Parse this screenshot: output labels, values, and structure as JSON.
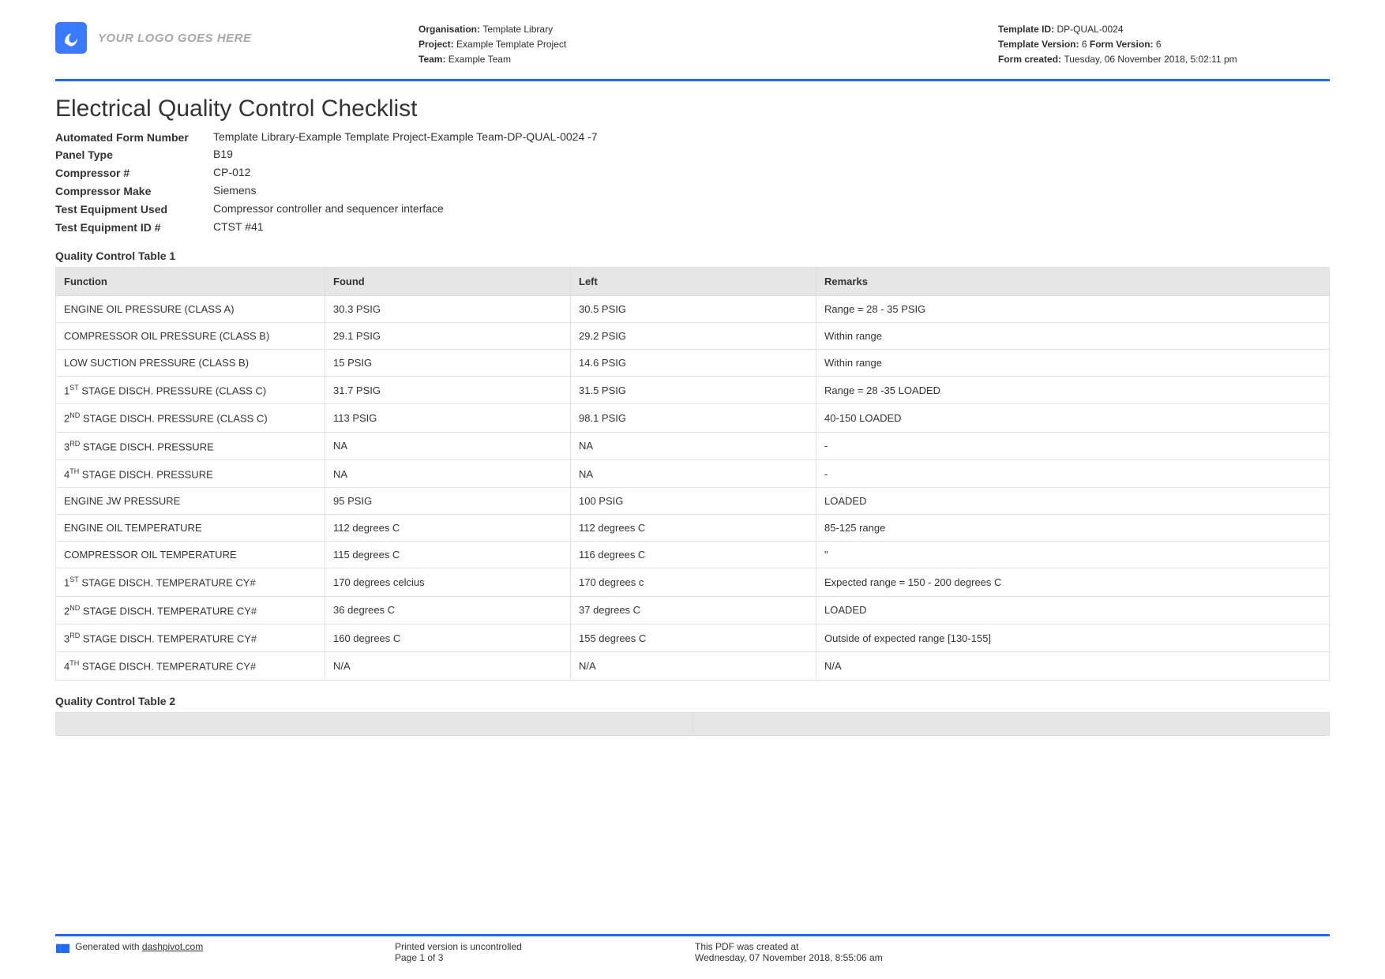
{
  "header": {
    "logo_placeholder": "YOUR LOGO GOES HERE",
    "org_label": "Organisation:",
    "org_value": "Template Library",
    "project_label": "Project:",
    "project_value": "Example Template Project",
    "team_label": "Team:",
    "team_value": "Example Team",
    "template_id_label": "Template ID:",
    "template_id_value": "DP-QUAL-0024",
    "template_version_label": "Template Version:",
    "template_version_value": "6",
    "form_version_label": "Form Version:",
    "form_version_value": "6",
    "form_created_label": "Form created:",
    "form_created_value": "Tuesday, 06 November 2018, 5:02:11 pm"
  },
  "title": "Electrical Quality Control Checklist",
  "fields": [
    {
      "k": "Automated Form Number",
      "v": "Template Library-Example Template Project-Example Team-DP-QUAL-0024   -7"
    },
    {
      "k": "Panel Type",
      "v": "B19"
    },
    {
      "k": "Compressor #",
      "v": "CP-012"
    },
    {
      "k": "Compressor Make",
      "v": "Siemens"
    },
    {
      "k": "Test Equipment Used",
      "v": "Compressor controller and sequencer interface"
    },
    {
      "k": "Test Equipment ID #",
      "v": "CTST #41"
    }
  ],
  "table1_title": "Quality Control Table 1",
  "table1_headers": [
    "Function",
    "Found",
    "Left",
    "Remarks"
  ],
  "table1_rows": [
    {
      "func": "ENGINE OIL PRESSURE (CLASS A)",
      "found": "30.3 PSIG",
      "left": "30.5 PSIG",
      "remarks": "Range = 28 - 35 PSIG"
    },
    {
      "func": "COMPRESSOR OIL PRESSURE (CLASS B)",
      "found": "29.1 PSIG",
      "left": "29.2 PSIG",
      "remarks": "Within range"
    },
    {
      "func": "LOW SUCTION PRESSURE (CLASS B)",
      "found": "15 PSIG",
      "left": "14.6 PSIG",
      "remarks": "Within range"
    },
    {
      "func": "1<sup>ST</sup> STAGE DISCH. PRESSURE (CLASS C)",
      "found": "31.7 PSIG",
      "left": "31.5 PSIG",
      "remarks": "Range = 28 -35 LOADED"
    },
    {
      "func": "2<sup>ND</sup> STAGE DISCH. PRESSURE (CLASS C)",
      "found": "113 PSIG",
      "left": "98.1 PSIG",
      "remarks": "40-150 LOADED"
    },
    {
      "func": "3<sup>RD</sup> STAGE DISCH. PRESSURE",
      "found": "NA",
      "left": "NA",
      "remarks": "-"
    },
    {
      "func": "4<sup>TH</sup> STAGE DISCH. PRESSURE",
      "found": "NA",
      "left": "NA",
      "remarks": "-"
    },
    {
      "func": "ENGINE JW PRESSURE",
      "found": "95 PSIG",
      "left": "100 PSIG",
      "remarks": "LOADED"
    },
    {
      "func": "ENGINE OIL TEMPERATURE",
      "found": "112 degrees C",
      "left": "112 degrees C",
      "remarks": "85-125 range"
    },
    {
      "func": "COMPRESSOR OIL TEMPERATURE",
      "found": "115 degrees C",
      "left": "116 degrees C",
      "remarks": "\""
    },
    {
      "func": "1<sup>ST</sup> STAGE DISCH. TEMPERATURE CY#",
      "found": "170 degrees celcius",
      "left": "170 degrees c",
      "remarks": "Expected range = 150 - 200 degrees C"
    },
    {
      "func": "2<sup>ND</sup> STAGE DISCH. TEMPERATURE CY#",
      "found": "36 degrees C",
      "left": "37 degrees C",
      "remarks": "LOADED"
    },
    {
      "func": "3<sup>RD</sup> STAGE DISCH. TEMPERATURE CY#",
      "found": "160 degrees C",
      "left": "155 degrees C",
      "remarks": "Outside of expected range [130-155]"
    },
    {
      "func": "4<sup>TH</sup> STAGE DISCH. TEMPERATURE CY#",
      "found": "N/A",
      "left": "N/A",
      "remarks": "N/A"
    }
  ],
  "table2_title": "Quality Control Table 2",
  "footer": {
    "generated_prefix": "Generated with ",
    "generated_link": "dashpivot.com",
    "uncontrolled": "Printed version is uncontrolled",
    "page": "Page 1 of 3",
    "created_label": "This PDF was created at",
    "created_value": "Wednesday, 07 November 2018, 8:55:06 am"
  }
}
